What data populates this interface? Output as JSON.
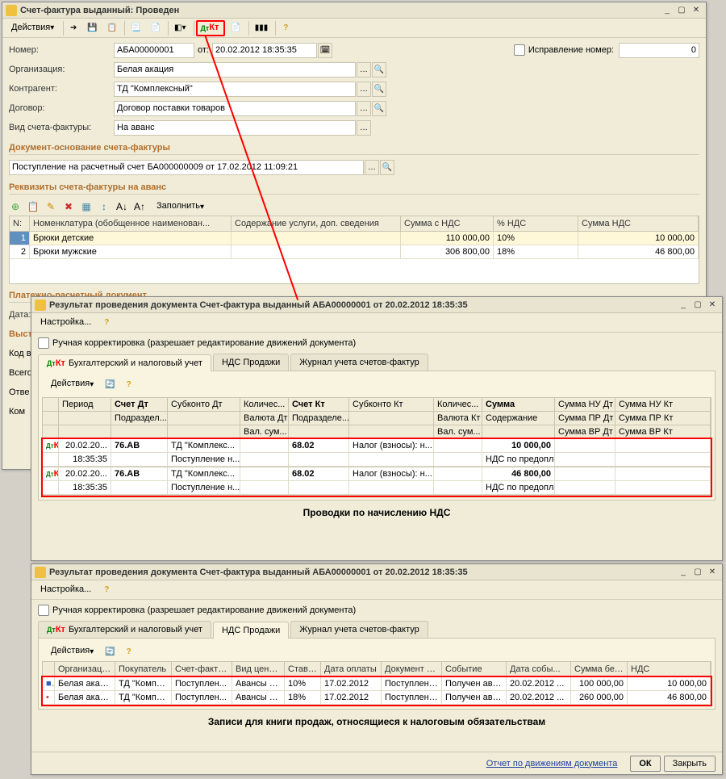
{
  "win1": {
    "title": "Счет-фактура выданный: Проведен",
    "actions_label": "Действия",
    "form": {
      "number_lbl": "Номер:",
      "number_val": "АБА00000001",
      "from_lbl": "от:",
      "date_val": "20.02.2012 18:35:35",
      "correction_lbl": "Исправление номер:",
      "correction_val": "0",
      "org_lbl": "Организация:",
      "org_val": "Белая акация",
      "counter_lbl": "Контрагент:",
      "counter_val": "ТД \"Комплексный\"",
      "contract_lbl": "Договор:",
      "contract_val": "Договор поставки товаров",
      "type_lbl": "Вид счета-фактуры:",
      "type_val": "На аванс",
      "basis_hdr": "Документ-основание счета-фактуры",
      "basis_val": "Поступление на расчетный счет БА000000009 от 17.02.2012 11:09:21",
      "req_hdr": "Реквизиты счета-фактуры на аванс",
      "fill_lbl": "Заполнить",
      "cols": {
        "n": "N:",
        "nomen": "Номенклатура (обобщенное наименован...",
        "content": "Содержание услуги, доп. сведения",
        "sum": "Сумма с НДС",
        "rate": "% НДС",
        "vat": "Сумма НДС"
      },
      "rows": [
        {
          "n": "1",
          "nomen": "Брюки детские",
          "content": "",
          "sum": "110 000,00",
          "rate": "10%",
          "vat": "10 000,00"
        },
        {
          "n": "2",
          "nomen": "Брюки мужские",
          "content": "",
          "sum": "306 800,00",
          "rate": "18%",
          "vat": "46 800,00"
        }
      ],
      "payment_hdr": "Платежно-расчетный документ",
      "date_lbl": "Дата:",
      "issued_lbl": "Выст",
      "code_lbl": "Код в",
      "total_lbl": "Всего",
      "resp_lbl": "Отве",
      "comm_lbl": "Ком"
    }
  },
  "win2": {
    "title": "Результат проведения документа Счет-фактура выданный АБА00000001 от 20.02.2012 18:35:35",
    "settings": "Настройка...",
    "manual_lbl": "Ручная корректировка (разрешает редактирование движений документа)",
    "tabs": {
      "accounting": "Бухгалтерский и налоговый учет",
      "vat_sales": "НДС Продажи",
      "journal": "Журнал учета счетов-фактур"
    },
    "actions": "Действия",
    "hdr": {
      "period": "Период",
      "dt": "Счет Дт",
      "sub_dt": "Субконто Дт",
      "qty_dt": "Количес...",
      "kt": "Счет Кт",
      "sub_kt": "Субконто Кт",
      "qty_kt": "Количес...",
      "sum": "Сумма",
      "nu_dt": "Сумма НУ Дт",
      "nu_kt": "Сумма НУ Кт",
      "dept_dt": "Подраздел... Дт",
      "cur_dt": "Валюта Дт",
      "dept_kt": "Подразделе... Кт",
      "cur_kt": "Валюта Кт",
      "content": "Содержание",
      "pr_dt": "Сумма ПР Дт",
      "pr_kt": "Сумма ПР Кт",
      "vs": "Вал. сум...",
      "vs2": "Вал. сум...",
      "vr_dt": "Сумма ВР Дт",
      "vr_kt": "Сумма ВР Кт"
    },
    "entries": [
      {
        "date": "20.02.20...",
        "time": "18:35:35",
        "dt": "76.АВ",
        "sub_dt1": "ТД \"Комплекс...",
        "sub_dt2": "Поступление н...",
        "kt": "68.02",
        "sub_kt": "Налог (взносы): н...",
        "sum": "10 000,00",
        "content": "НДС по предоплате"
      },
      {
        "date": "20.02.20...",
        "time": "18:35:35",
        "dt": "76.АВ",
        "sub_dt1": "ТД \"Комплекс...",
        "sub_dt2": "Поступление н...",
        "kt": "68.02",
        "sub_kt": "Налог (взносы): н...",
        "sum": "46 800,00",
        "content": "НДС по предоплате"
      }
    ],
    "caption": "Проводки по начислению НДС"
  },
  "win3": {
    "title": "Результат проведения документа Счет-фактура выданный АБА00000001 от 20.02.2012 18:35:35",
    "settings": "Настройка...",
    "manual_lbl": "Ручная корректировка (разрешает редактирование движений документа)",
    "tabs": {
      "accounting": "Бухгалтерский и налоговый учет",
      "vat_sales": "НДС Продажи",
      "journal": "Журнал учета счетов-фактур"
    },
    "actions": "Действия",
    "hdr": {
      "org": "Организация",
      "buyer": "Покупатель",
      "invoice": "Счет-фактура",
      "type": "Вид ценно...",
      "rate": "Ставк...",
      "paydate": "Дата оплаты",
      "doc": "Документ о...",
      "event": "Событие",
      "eventdate": "Дата собы...",
      "sum": "Сумма без ...",
      "vat": "НДС"
    },
    "rows": [
      {
        "org": "Белая акац...",
        "buyer": "ТД \"Компл...",
        "invoice": "Поступлен...",
        "type": "Авансы п...",
        "rate": "10%",
        "paydate": "17.02.2012",
        "doc": "Поступлени...",
        "event": "Получен ава...",
        "eventdate": "20.02.2012 ...",
        "sum": "100 000,00",
        "vat": "10 000,00"
      },
      {
        "org": "Белая акац...",
        "buyer": "ТД \"Компл...",
        "invoice": "Поступлен...",
        "type": "Авансы п...",
        "rate": "18%",
        "paydate": "17.02.2012",
        "doc": "Поступлени...",
        "event": "Получен ава...",
        "eventdate": "20.02.2012 ...",
        "sum": "260 000,00",
        "vat": "46 800,00"
      }
    ],
    "caption": "Записи для книги продаж, относящиеся к налоговым обязательствам",
    "report_link": "Отчет по движениям документа",
    "ok": "ОК",
    "close": "Закрыть"
  }
}
